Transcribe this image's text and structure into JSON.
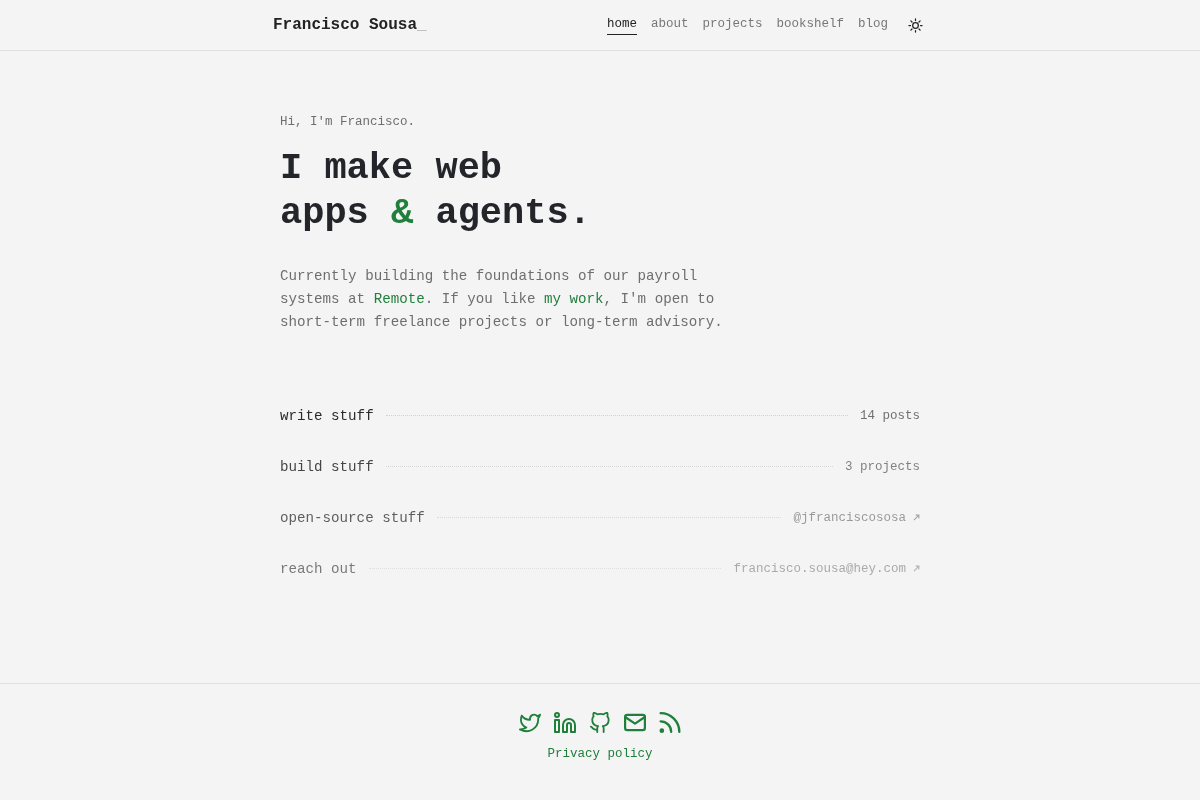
{
  "header": {
    "logo": "Francisco Sousa",
    "cursor": "_",
    "nav": [
      {
        "label": "home",
        "selected": true
      },
      {
        "label": "about",
        "selected": false
      },
      {
        "label": "projects",
        "selected": false
      },
      {
        "label": "bookshelf",
        "selected": false
      },
      {
        "label": "blog",
        "selected": false
      }
    ]
  },
  "hero": {
    "greeting": "Hi, I'm Francisco.",
    "headline": [
      {
        "text": "I make web apps ",
        "accent": false
      },
      {
        "text": "&",
        "accent": true
      },
      {
        "text": " agents.",
        "accent": false
      }
    ],
    "intro": [
      {
        "text": "Currently building the foundations of our payroll systems at ",
        "link": false
      },
      {
        "text": "Remote",
        "link": true
      },
      {
        "text": ". If you like ",
        "link": false
      },
      {
        "text": "my work",
        "link": true
      },
      {
        "text": ", I'm open to short-term freelance projects or long-term advisory.",
        "link": false
      }
    ]
  },
  "sections": [
    {
      "label": "write stuff",
      "detail": "14 posts",
      "external": false
    },
    {
      "label": "build stuff",
      "detail": "3 projects",
      "external": false
    },
    {
      "label": "open-source stuff",
      "detail": "@jfranciscososa",
      "external": true
    },
    {
      "label": "reach out",
      "detail": "francisco.sousa@hey.com",
      "external": true
    }
  ],
  "footer": {
    "privacy_link": "Privacy policy"
  }
}
